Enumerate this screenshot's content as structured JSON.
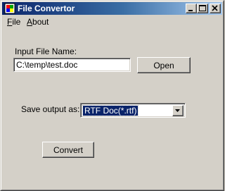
{
  "window": {
    "title": "File Convertor",
    "colors": {
      "face": "#d4d0c8",
      "title_start": "#0a246a",
      "title_end": "#a6caf0",
      "selection": "#0a246a"
    }
  },
  "menubar": {
    "items": [
      {
        "label": "File",
        "accel": "F",
        "rest": "ile"
      },
      {
        "label": "About",
        "accel": "A",
        "rest": "bout"
      }
    ]
  },
  "form": {
    "input_label": "Input File Name:",
    "input_value": "C:\\temp\\test.doc",
    "open_label": "Open",
    "save_label": "Save output as:",
    "save_selected": "RTF Doc(*.rtf)",
    "convert_label": "Convert"
  },
  "icons": {
    "app": "app-icon",
    "minimize": "minimize-icon",
    "maximize": "maximize-icon",
    "close": "close-icon",
    "dropdown": "chevron-down-icon"
  }
}
